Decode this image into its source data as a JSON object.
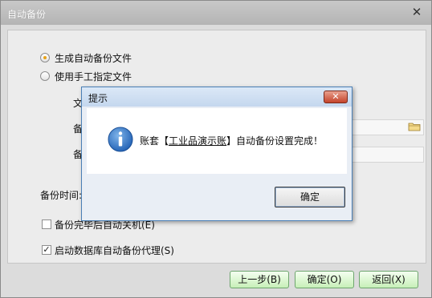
{
  "window": {
    "title": "自动备份",
    "close_glyph": "✕"
  },
  "options": {
    "generate_label": "生成自动备份文件",
    "manual_label": "使用手工指定文件"
  },
  "form": {
    "file_label_fragment": "文",
    "backup_label_fragment_1": "备",
    "backup_label_fragment_2": "备",
    "backup_time_label": "备份时间:",
    "shutdown_label": "备份完毕后自动关机(E)",
    "agent_label": "启动数据库自动备份代理(S)",
    "agent_checked_glyph": "✓"
  },
  "buttons": {
    "prev": "上一步(B)",
    "ok": "确定(O)",
    "back": "返回(X)"
  },
  "dialog": {
    "title": "提示",
    "close_glyph": "✕",
    "msg_prefix": "账套【",
    "msg_account": "工业品演示账",
    "msg_suffix": "】自动备份设置完成！",
    "ok_label": "确定"
  }
}
